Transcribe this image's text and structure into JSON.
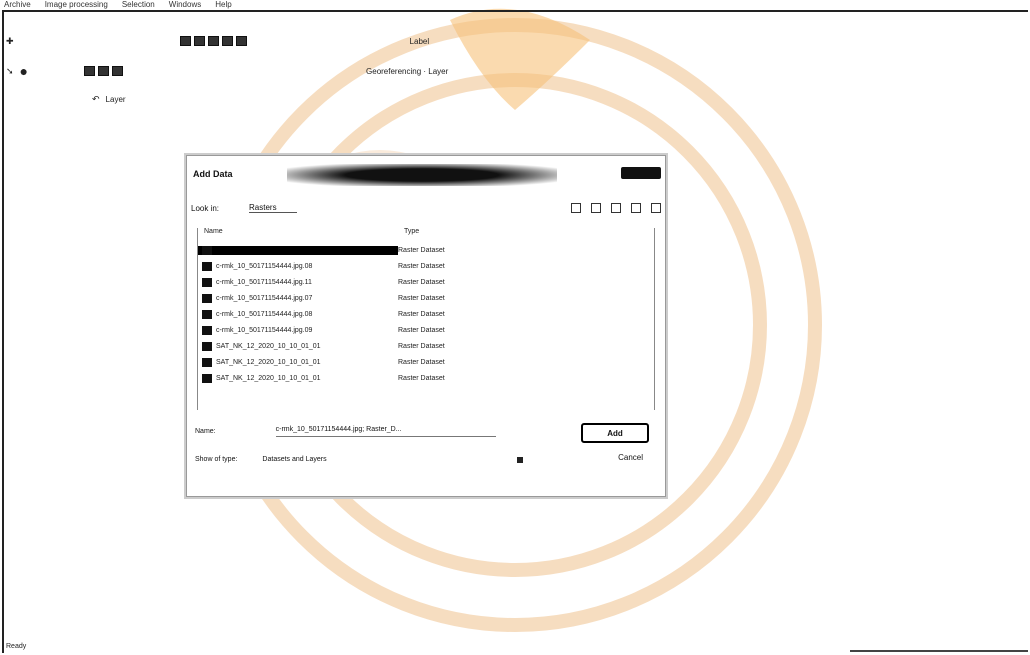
{
  "menu": [
    "Archive",
    "Image processing",
    "Selection",
    "Windows",
    "Help"
  ],
  "toolbar": {
    "row1_label": "Label",
    "row2_label": "Georeferencing · Layer",
    "row3_label": "Layer"
  },
  "dialog": {
    "title": "Add Data",
    "look_in_label": "Look in:",
    "look_in_value": "Rasters",
    "columns": {
      "name": "Name",
      "type": "Type"
    },
    "rows": [
      {
        "name": "",
        "type": "Raster Dataset"
      },
      {
        "name": "c-rmk_10_50171154444.jpg.08",
        "type": "Raster Dataset"
      },
      {
        "name": "c-rmk_10_50171154444.jpg.11",
        "type": "Raster Dataset"
      },
      {
        "name": "c-rmk_10_50171154444.jpg.07",
        "type": "Raster Dataset"
      },
      {
        "name": "c-rmk_10_50171154444.jpg.08",
        "type": "Raster Dataset"
      },
      {
        "name": "c-rmk_10_50171154444.jpg.09",
        "type": "Raster Dataset"
      },
      {
        "name": "SAT_NK_12_2020_10_10_01_01",
        "type": "Raster Dataset"
      },
      {
        "name": "SAT_NK_12_2020_10_10_01_01",
        "type": "Raster Dataset"
      },
      {
        "name": "SAT_NK_12_2020_10_10_01_01",
        "type": "Raster Dataset"
      }
    ],
    "name_label": "Name:",
    "name_value": "c-rmk_10_50171154444.jpg; Raster_D...",
    "show_label": "Show of type:",
    "show_value": "Datasets and Layers",
    "add_label": "Add",
    "cancel_label": "Cancel"
  },
  "status": "Ready"
}
